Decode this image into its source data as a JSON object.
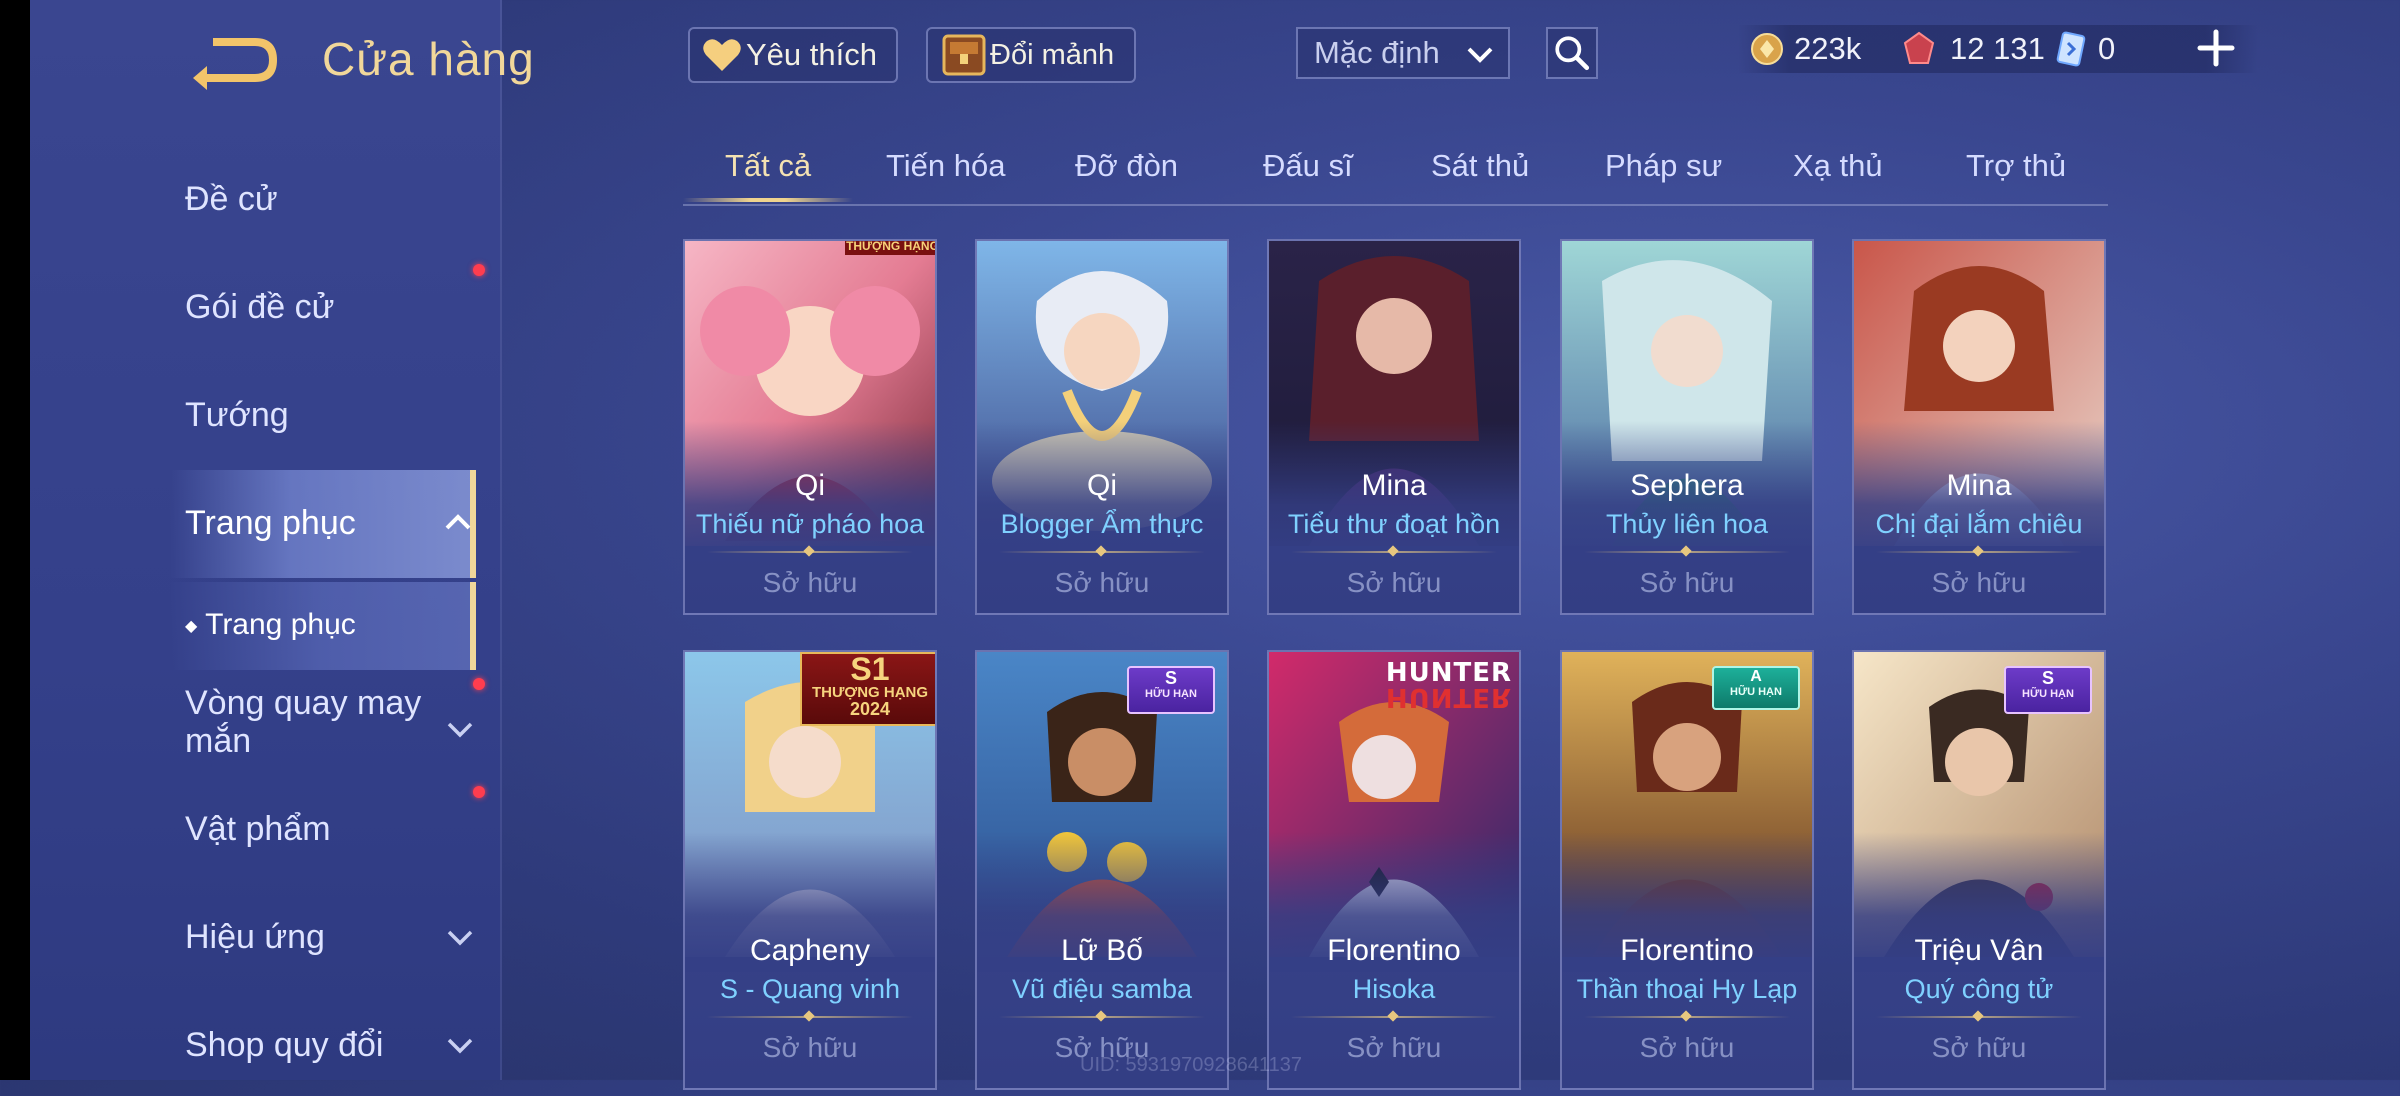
{
  "header": {
    "title": "Cửa hàng",
    "favorites_label": "Yêu thích",
    "exchange_label": "Đổi mảnh",
    "sort_value": "Mặc định"
  },
  "currencies": {
    "gold": "223k",
    "vouchers": "12 131",
    "coupons": "0"
  },
  "sidebar": {
    "items": [
      {
        "label": "Đề cử"
      },
      {
        "label": "Gói đề cử"
      },
      {
        "label": "Tướng"
      },
      {
        "label": "Trang phục"
      },
      {
        "label": "Trang phục"
      },
      {
        "label": "Vòng quay may mắn"
      },
      {
        "label": "Vật phẩm"
      },
      {
        "label": "Hiệu ứng"
      },
      {
        "label": "Shop quy đổi"
      }
    ]
  },
  "tabs": [
    "Tất cả",
    "Tiến hóa",
    "Đỡ đòn",
    "Đấu sĩ",
    "Sát thủ",
    "Pháp sư",
    "Xạ thủ",
    "Trợ thủ"
  ],
  "cards": [
    {
      "hero": "Qi",
      "skin": "Thiếu nữ pháo hoa",
      "status": "Sở hữu",
      "badge": "THƯỢNG HẠNG"
    },
    {
      "hero": "Qi",
      "skin": "Blogger Ẩm thực",
      "status": "Sở hữu"
    },
    {
      "hero": "Mina",
      "skin": "Tiểu thư đoạt hồn",
      "status": "Sở hữu"
    },
    {
      "hero": "Sephera",
      "skin": "Thủy liên hoa",
      "status": "Sở hữu"
    },
    {
      "hero": "Mina",
      "skin": "Chị đại lắm chiêu",
      "status": "Sở hữu"
    },
    {
      "hero": "Capheny",
      "skin": "S - Quang vinh",
      "status": "Sở hữu",
      "badge": "S1",
      "badge2": "THƯỢNG HẠNG",
      "badge3": "2024"
    },
    {
      "hero": "Lữ Bố",
      "skin": "Vũ điệu samba",
      "status": "Sở hữu",
      "badge": "S",
      "badge2": "HỮU HẠN"
    },
    {
      "hero": "Florentino",
      "skin": "Hisoka",
      "status": "Sở hữu",
      "badge": "HUNTER",
      "badge2": "HUNTER"
    },
    {
      "hero": "Florentino",
      "skin": "Thần thoại Hy Lạp",
      "status": "Sở hữu",
      "badge": "A",
      "badge2": "HỮU HẠN"
    },
    {
      "hero": "Triệu Vân",
      "skin": "Quý công tử",
      "status": "Sở hữu",
      "badge": "S",
      "badge2": "HỮU HẠN"
    }
  ],
  "footer": {
    "uid": "UID: 5931970928641137"
  },
  "colors": {
    "background": "#3a4790",
    "accent_gold": "#f0d48e",
    "skin_name": "#7fd1ff",
    "notification": "#ff3d4f"
  }
}
